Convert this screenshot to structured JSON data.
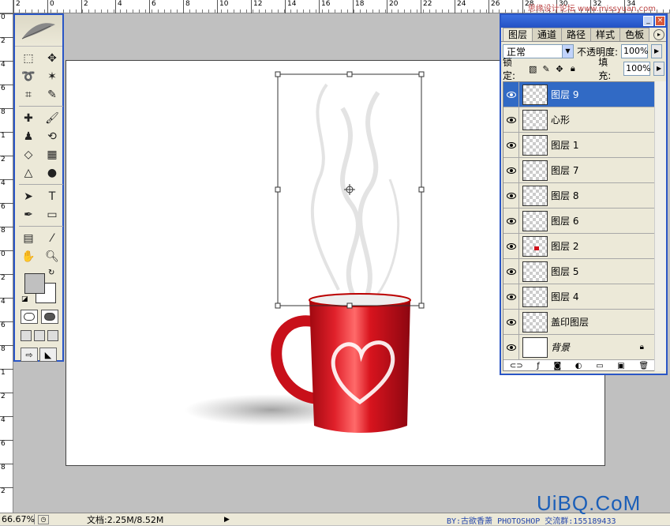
{
  "watermark_top": "思缘设计论坛 www.missyuan.com",
  "ruler": {
    "top_labels": [
      "2",
      "0",
      "2",
      "4",
      "6",
      "8",
      "10",
      "12",
      "14",
      "16",
      "18",
      "20",
      "22",
      "24",
      "26",
      "28",
      "30",
      "32",
      "34"
    ],
    "left_labels": [
      "0",
      "2",
      "4",
      "6",
      "8",
      "1",
      "2",
      "4",
      "6",
      "8",
      "0",
      "2",
      "4",
      "6",
      "8",
      "1",
      "2",
      "4",
      "6",
      "8",
      "2"
    ]
  },
  "toolbox": {
    "tools": [
      [
        "marquee-icon",
        "move-icon"
      ],
      [
        "lasso-icon",
        "magic-wand-icon"
      ],
      [
        "crop-icon",
        "slice-icon"
      ],
      [
        "healing-brush-icon",
        "brush-icon"
      ],
      [
        "stamp-icon",
        "history-brush-icon"
      ],
      [
        "eraser-icon",
        "gradient-icon"
      ],
      [
        "blur-icon",
        "dodge-icon"
      ],
      [
        "path-select-icon",
        "type-icon"
      ],
      [
        "pen-icon",
        "rectangle-icon"
      ],
      [
        "notes-icon",
        "eyedropper-icon"
      ],
      [
        "hand-icon",
        "zoom-icon"
      ]
    ],
    "foreground_color": "#c0c0c0",
    "background_color": "#ffffff"
  },
  "panel": {
    "tabs": [
      "图层",
      "通道",
      "路径",
      "样式",
      "色板"
    ],
    "blend_mode": "正常",
    "opacity_label": "不透明度:",
    "opacity_value": "100%",
    "lock_label": "锁定:",
    "fill_label": "填充:",
    "fill_value": "100%",
    "layers": [
      {
        "name": "图层 9",
        "selected": true,
        "thumb": "transparent"
      },
      {
        "name": "心形",
        "selected": false,
        "thumb": "transparent"
      },
      {
        "name": "图层 1",
        "selected": false,
        "thumb": "transparent"
      },
      {
        "name": "图层 7",
        "selected": false,
        "thumb": "transparent"
      },
      {
        "name": "图层 8",
        "selected": false,
        "thumb": "transparent"
      },
      {
        "name": "图层 6",
        "selected": false,
        "thumb": "transparent"
      },
      {
        "name": "图层 2",
        "selected": false,
        "thumb": "red"
      },
      {
        "name": "图层 5",
        "selected": false,
        "thumb": "transparent"
      },
      {
        "name": "图层 4",
        "selected": false,
        "thumb": "transparent"
      },
      {
        "name": "盖印图层",
        "selected": false,
        "thumb": "transparent"
      },
      {
        "name": "背景",
        "selected": false,
        "thumb": "white",
        "locked": true
      }
    ]
  },
  "status": {
    "zoom": "66.67%",
    "doc": "文档:2.25M/8.52M"
  },
  "credit": "BY:古欲香萧  PHOTOSHOP 交流群:155189433",
  "logo": "UiBQ.CoM",
  "colors": {
    "mug_red": "#d0121b",
    "selection_blue": "#316ac5",
    "window_border": "#2a56c6"
  }
}
